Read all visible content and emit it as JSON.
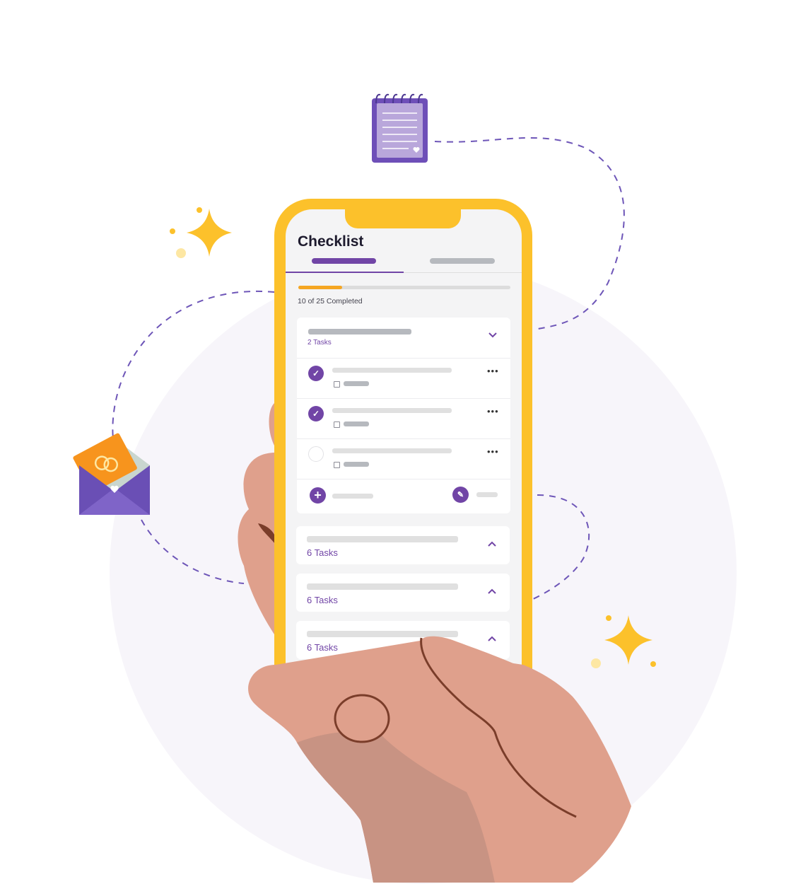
{
  "screen": {
    "title": "Checklist",
    "progress": {
      "completed": 10,
      "total": 25,
      "text": "10 of 25 Completed"
    },
    "groups": [
      {
        "tasks_label": "2 Tasks",
        "expanded": true,
        "items": [
          {
            "checked": true
          },
          {
            "checked": true
          },
          {
            "checked": false
          }
        ]
      },
      {
        "tasks_label": "6 Tasks",
        "expanded": false
      },
      {
        "tasks_label": "6 Tasks",
        "expanded": false
      },
      {
        "tasks_label": "6 Tasks",
        "expanded": false
      }
    ]
  },
  "icons": {
    "notepad": "notepad-icon",
    "envelope": "envelope-rings-icon",
    "sparkle": "sparkle-icon",
    "check": "checkmark-icon",
    "more": "more-dots-icon",
    "calendar": "calendar-icon",
    "add": "plus-icon",
    "edit": "pencil-icon",
    "chevron_down": "chevron-down-icon",
    "chevron_up": "chevron-up-icon"
  },
  "colors": {
    "accent_purple": "#7145a6",
    "phone_yellow": "#fcc12b",
    "progress_orange": "#f5a623",
    "skin": "#dfa08c",
    "skin_shadow": "#c89383",
    "background_circle": "#f7f5fa"
  }
}
